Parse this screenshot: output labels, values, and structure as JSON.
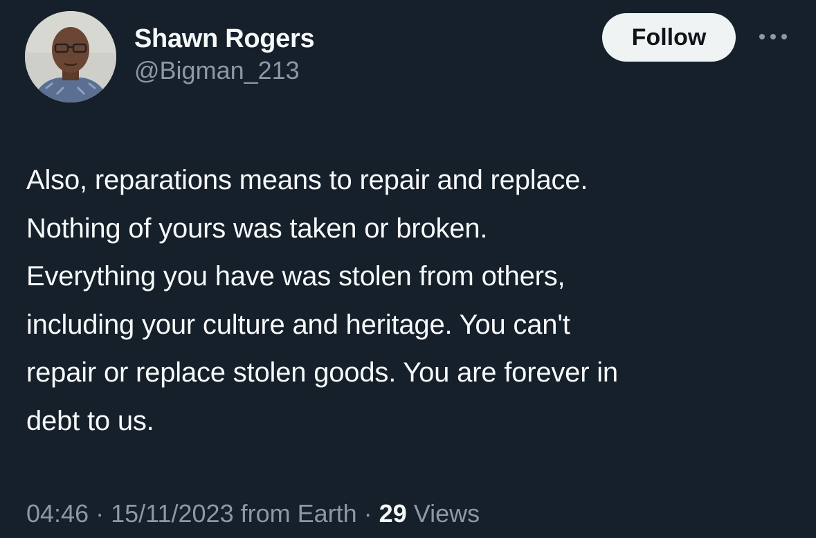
{
  "author": {
    "display_name": "Shawn Rogers",
    "handle": "@Bigman_213"
  },
  "actions": {
    "follow_label": "Follow",
    "more_icon": "more-horizontal-icon"
  },
  "tweet": {
    "text": "Also, reparations means to repair and replace.\nNothing of yours was taken or broken.\nEverything you have was stolen from others,\nincluding your culture and heritage. You can't\nrepair or replace stolen goods. You are forever in\ndebt to us."
  },
  "meta": {
    "time": "04:46",
    "separator": "·",
    "date": "15/11/2023",
    "location": "from Earth",
    "views_count": "29",
    "views_label": "Views"
  },
  "colors": {
    "background": "#15202b",
    "primary_text": "#f7f9f9",
    "secondary_text": "#8b98a5",
    "follow_button_bg": "#eff3f4",
    "follow_button_text": "#0f1419"
  }
}
